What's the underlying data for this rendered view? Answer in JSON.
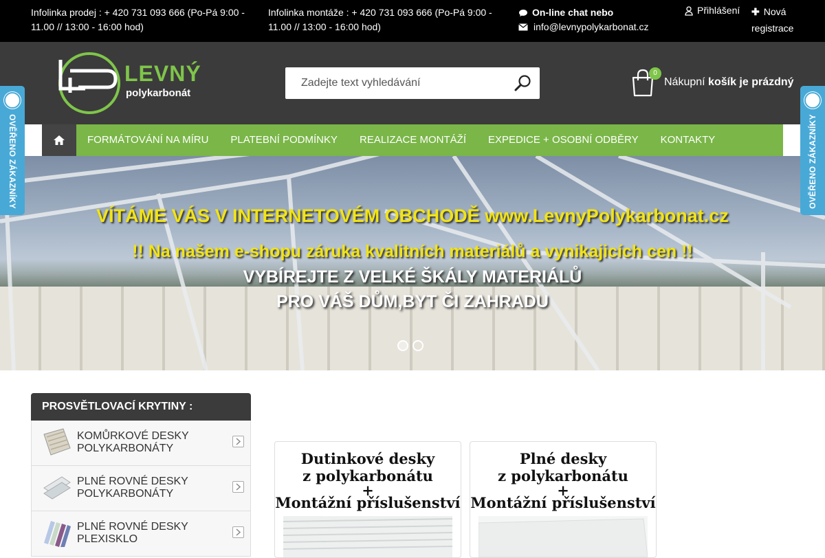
{
  "topbar": {
    "sales_line": "Infolinka prodej : + 420 731 093 666 (Po-Pá 9:00 - 11.00 // 13:00 - 16:00 hod)",
    "install_line": "Infolinka montáže : + 420 731 093 666 (Po-Pá 9:00 - 11.00 // 13:00 - 16:00 hod)",
    "chat_label": "On-line chat nebo",
    "email": "info@levnypolykarbonat.cz",
    "login": "Přihlášení",
    "register": "Nová registrace"
  },
  "header": {
    "logo_word1": "LEVNÝ",
    "logo_word2": "polykarbonát",
    "search_placeholder": "Zadejte text vyhledávání",
    "cart_count": "0",
    "cart_prefix": "Nákupní",
    "cart_status": "košík je prázdný"
  },
  "nav": {
    "items": [
      "FORMÁTOVÁNÍ NA MÍRU",
      "PLATEBNÍ PODMÍNKY",
      "REALIZACE MONTÁŽÍ",
      "EXPEDICE + OSOBNÍ ODBĚRY",
      "KONTAKTY"
    ]
  },
  "hero": {
    "line1": "VÍTÁME VÁS V INTERNETOVÉM OBCHODĚ www.LevnyPolykarbonat.cz",
    "line2": "!! Na našem e-shopu záruka kvalitních materiálů a vynikajicích cen !!",
    "line3": "VYBÍREJTE Z VELKÉ ŠKÁLY MATERIÁLŮ",
    "line4": "PRO VÁŠ DŮM,BYT ČI ZAHRADU",
    "slides": 2,
    "active_slide": 1
  },
  "verified": {
    "label": "OVĚŘENO ZÁKAZNÍKY"
  },
  "categories": {
    "heading": "PROSVĚTLOVACÍ KRYTINY :",
    "items": [
      "KOMŮRKOVÉ DESKY POLYKARBONÁTY",
      "PLNÉ ROVNÉ DESKY POLYKARBONÁTY",
      "PLNÉ ROVNÉ DESKY PLEXISKLO"
    ]
  },
  "cards": [
    {
      "l1": "Dutinkové desky",
      "l2": "z polykarbonátu",
      "l3": "+",
      "l4": "Montážní příslušenství"
    },
    {
      "l1": "Plné desky",
      "l2": "z polykarbonátu",
      "l3": "+",
      "l4": "Montážní příslušenství"
    }
  ],
  "colors": {
    "accent_green": "#7ab648",
    "header_dark": "#3b3b3b",
    "badge_blue": "#48a9d7"
  }
}
